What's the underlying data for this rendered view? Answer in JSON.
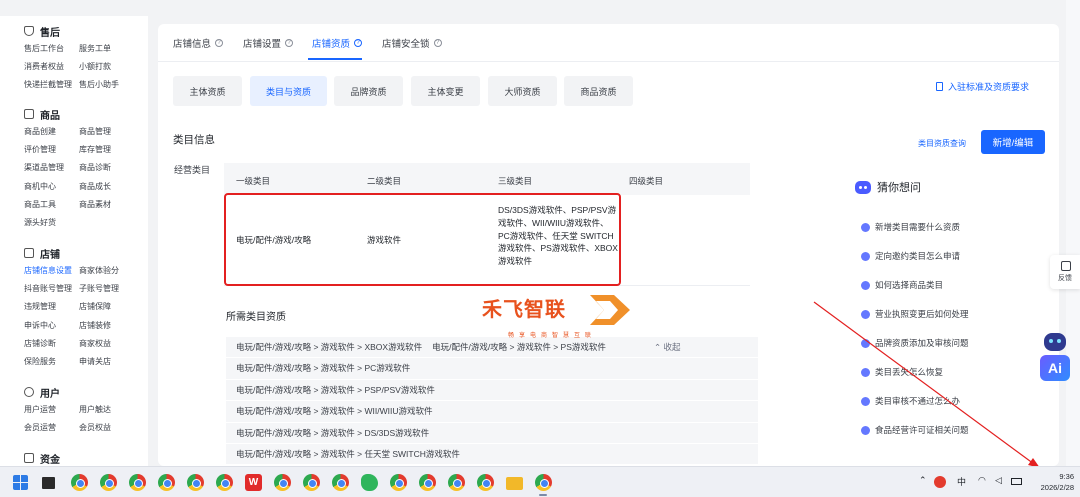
{
  "sidebar": {
    "groups": [
      {
        "title": "售后",
        "icon": "shield-icon",
        "items": [
          "售后工作台",
          "服务工单",
          "消费者权益",
          "小额打款",
          "快递拦截管理",
          "售后小助手"
        ]
      },
      {
        "title": "商品",
        "icon": "box-icon",
        "items": [
          "商品创建",
          "商品管理",
          "评价管理",
          "库存管理",
          "渠道品管理",
          "商品诊断",
          "商机中心",
          "商品成长",
          "商品工具",
          "商品素材",
          "源头好货",
          ""
        ]
      },
      {
        "title": "店铺",
        "icon": "store-icon",
        "items": [
          "店铺信息设置",
          "商家体验分",
          "抖音账号管理",
          "子账号管理",
          "违规管理",
          "店铺保障",
          "申诉中心",
          "店铺装修",
          "店铺诊断",
          "商家权益",
          "保险服务",
          "申请关店"
        ]
      },
      {
        "title": "用户",
        "icon": "user-icon",
        "items": [
          "用户运营",
          "用户触达",
          "会员运营",
          "会员权益"
        ]
      },
      {
        "title": "资金",
        "icon": "wallet-icon",
        "items": []
      }
    ],
    "active_item": "店铺信息设置"
  },
  "tabs": [
    "店铺信息",
    "店铺设置",
    "店铺资质",
    "店铺安全锁"
  ],
  "active_tab": "店铺资质",
  "subtabs": [
    "主体资质",
    "类目与资质",
    "品牌资质",
    "主体变更",
    "大师资质",
    "商品资质"
  ],
  "active_subtab": "类目与资质",
  "requirements_link": "入驻标准及资质要求",
  "section_title": "类目信息",
  "query_link": "类目资质查询",
  "add_edit_button": "新增/编辑",
  "field_label": "经营类目",
  "category_table": {
    "headers": [
      "一级类目",
      "二级类目",
      "三级类目",
      "四级类目"
    ],
    "row": {
      "level1": "电玩/配件/游戏/攻略",
      "level2": "游戏软件",
      "level3": "DS/3DS游戏软件、PSP/PSV游戏软件、WII/WIIU游戏软件、PC游戏软件、任天堂 SWITCH游戏软件、PS游戏软件、XBOX游戏软件",
      "level4": ""
    }
  },
  "required_title": "所需类目资质",
  "required_rows": [
    {
      "text": "电玩/配件/游戏/攻略 > 游戏软件 > XBOX游戏软件",
      "text2": "电玩/配件/游戏/攻略 > 游戏软件 > PS游戏软件",
      "collapse": "收起"
    },
    {
      "text": "电玩/配件/游戏/攻略 > 游戏软件 > PC游戏软件"
    },
    {
      "text": "电玩/配件/游戏/攻略 > 游戏软件 > PSP/PSV游戏软件"
    },
    {
      "text": "电玩/配件/游戏/攻略 > 游戏软件 > WII/WIIU游戏软件"
    },
    {
      "text": "电玩/配件/游戏/攻略 > 游戏软件 > DS/3DS游戏软件"
    },
    {
      "text": "电玩/配件/游戏/攻略 > 游戏软件 > 任天堂 SWITCH游戏软件"
    }
  ],
  "guess": {
    "title": "猜你想问",
    "items": [
      "新增类目需要什么资质",
      "定向邀约类目怎么申请",
      "如何选择商品类目",
      "营业执照变更后如何处理",
      "品牌资质添加及审核问题",
      "类目丢失怎么恢复",
      "类目审核不通过怎么办",
      "食品经营许可证相关问题"
    ]
  },
  "watermark": {
    "main": "禾飞智联",
    "sub": "畅享电商智慧互联"
  },
  "feedback_label": "反馈",
  "ai_label": "Ai",
  "taskbar": {
    "apps": [
      "start-icon",
      "desktop-icon",
      "chrome-icon",
      "chrome-icon",
      "chrome-icon",
      "chrome-icon",
      "chrome-icon",
      "chrome-icon",
      "wps-icon",
      "chrome-icon",
      "chrome-icon",
      "chrome-icon",
      "green-app-icon",
      "chrome-icon",
      "chrome-icon",
      "chrome-icon",
      "folder-icon",
      "chrome-icon"
    ],
    "tray": {
      "ime": "中",
      "time": "9:36",
      "date": "2026/2/28"
    }
  },
  "colors": {
    "accent": "#1966ff",
    "highlight_box": "#e32020",
    "watermark": "#e8521e"
  }
}
